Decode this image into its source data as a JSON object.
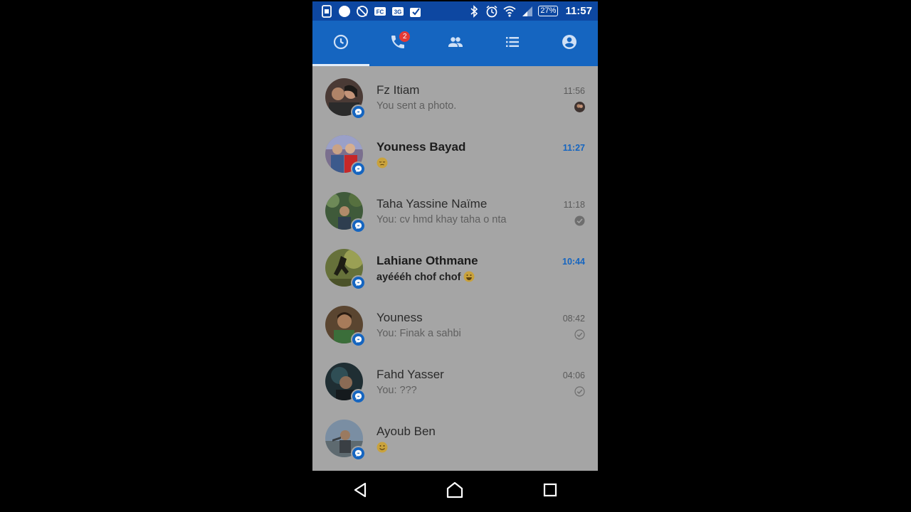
{
  "status_bar": {
    "battery_percent": "27%",
    "time": "11:57",
    "left_icons": [
      "sim-icon",
      "circle-icon",
      "no-location-icon",
      "fc-icon",
      "3g-icon",
      "checkbox-icon"
    ],
    "right_icons": [
      "bluetooth-icon",
      "alarm-icon",
      "wifi-icon",
      "signal-icon",
      "battery-icon"
    ]
  },
  "tabs": [
    {
      "id": "recent",
      "icon": "clock-icon",
      "active": true
    },
    {
      "id": "calls",
      "icon": "phone-icon",
      "badge": "2"
    },
    {
      "id": "people",
      "icon": "people-icon"
    },
    {
      "id": "groups",
      "icon": "list-icon"
    },
    {
      "id": "profile",
      "icon": "account-icon"
    }
  ],
  "conversations": [
    {
      "name": "Fz Itiam",
      "snippet": "You sent a photo.",
      "time": "11:56",
      "unread": false,
      "status": "seen-avatar"
    },
    {
      "name": "Youness Bayad",
      "snippet": "",
      "time": "11:27",
      "unread": true,
      "status": "none",
      "emoji": "sleepy"
    },
    {
      "name": "Taha Yassine Naïme",
      "snippet": "You: cv hmd khay taha o nta",
      "time": "11:18",
      "unread": false,
      "status": "delivered"
    },
    {
      "name": "Lahiane Othmane",
      "snippet": "ayéééh chof chof",
      "time": "10:44",
      "unread": true,
      "status": "none",
      "emoji": "grin"
    },
    {
      "name": "Youness",
      "snippet": "You: Finak a sahbi",
      "time": "08:42",
      "unread": false,
      "status": "sent"
    },
    {
      "name": "Fahd Yasser",
      "snippet": "You: ???",
      "time": "04:06",
      "unread": false,
      "status": "sent"
    },
    {
      "name": "Ayoub Ben",
      "snippet": "",
      "time": "",
      "unread": false,
      "status": "none",
      "emoji": "smile"
    }
  ],
  "fab": {
    "label": "+"
  },
  "colors": {
    "accent": "#1565c0",
    "statusbar": "#0d47a1",
    "list_dim": "#a5a5a5"
  }
}
